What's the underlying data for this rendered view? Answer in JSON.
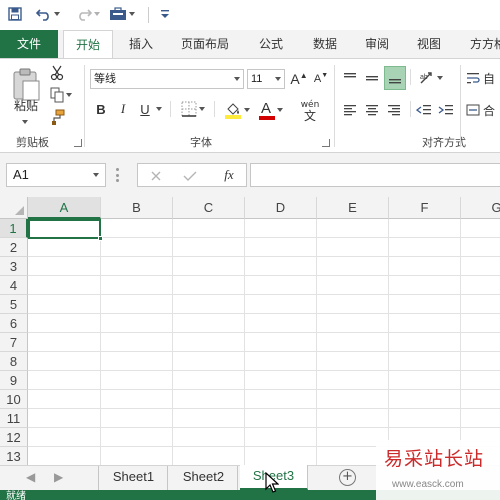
{
  "colors": {
    "accent": "#217346",
    "tab_bar": "#f3f3f3",
    "watermark_red": "#cc2a2a"
  },
  "quick_access": {
    "icons": [
      "save-icon",
      "undo-icon",
      "redo-icon",
      "touch-mode-icon",
      "customize-icon"
    ]
  },
  "ribbon_tabs": [
    "文件",
    "开始",
    "插入",
    "页面布局",
    "公式",
    "数据",
    "审阅",
    "视图",
    "方方格子"
  ],
  "active_tab": "开始",
  "clipboard": {
    "paste_label": "粘贴",
    "group_label": "剪贴板"
  },
  "font": {
    "name": "等线",
    "size": "11",
    "group_label": "字体",
    "bold": "B",
    "italic": "I",
    "underline": "U",
    "phonetic": "wén",
    "phonetic_char": "文",
    "grow": "A",
    "shrink": "A",
    "font_color": "A"
  },
  "alignment": {
    "group_label": "对齐方式",
    "wrap_label": "自",
    "merge_label": "合"
  },
  "formula_bar": {
    "name_box": "A1",
    "fx": "fx",
    "formula": ""
  },
  "grid": {
    "columns": [
      "A",
      "B",
      "C",
      "D",
      "E",
      "F",
      "G"
    ],
    "rows": [
      "1",
      "2",
      "3",
      "4",
      "5",
      "6",
      "7",
      "8",
      "9",
      "10",
      "11",
      "12",
      "13"
    ],
    "selected_cell": "A1"
  },
  "sheets": [
    "Sheet1",
    "Sheet2",
    "Sheet3"
  ],
  "active_sheet": "Sheet3",
  "add_sheet": "+",
  "status": {
    "text": "就绪"
  },
  "watermark": {
    "title": "易采站长站",
    "url": "www.easck.com"
  }
}
